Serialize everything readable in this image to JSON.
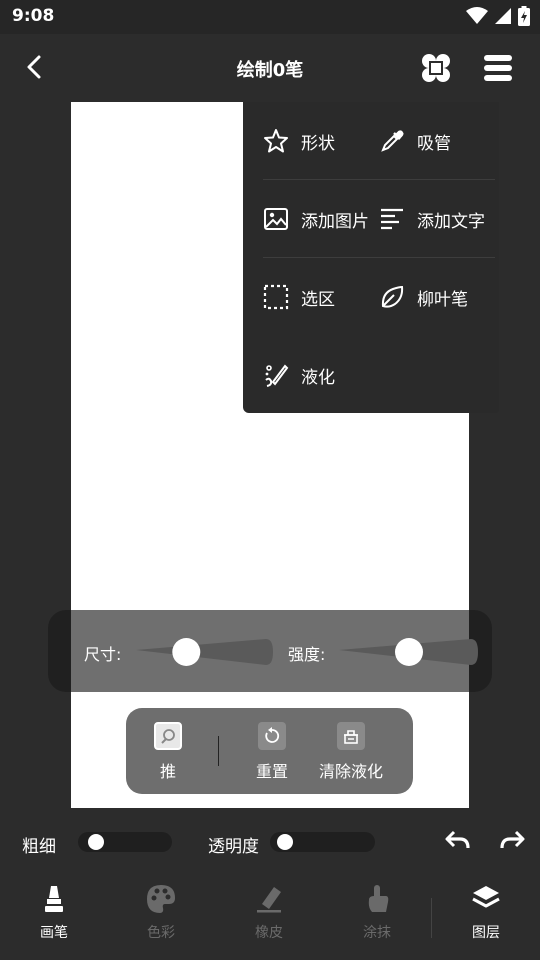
{
  "status_bar": {
    "time": "9:08"
  },
  "header": {
    "title": "绘制0笔"
  },
  "menu": {
    "items": [
      {
        "label": "形状",
        "icon": "star-icon"
      },
      {
        "label": "吸管",
        "icon": "eyedropper-icon"
      },
      {
        "label": "添加图片",
        "icon": "image-icon"
      },
      {
        "label": "添加文字",
        "icon": "text-lines-icon"
      },
      {
        "label": "选区",
        "icon": "selection-icon"
      },
      {
        "label": "柳叶笔",
        "icon": "leaf-icon"
      },
      {
        "label": "液化",
        "icon": "liquify-icon"
      }
    ]
  },
  "liquify_sliders": {
    "size_label": "尺寸:",
    "size_value": 0.33,
    "strength_label": "强度:",
    "strength_value": 0.5
  },
  "liquify_tools": {
    "push_label": "推",
    "reset_label": "重置",
    "clear_label": "清除液化"
  },
  "brush_controls": {
    "thickness_label": "粗细",
    "thickness_value": 0.1,
    "opacity_label": "透明度",
    "opacity_value": 0.05
  },
  "bottom_nav": {
    "items": [
      {
        "label": "画笔",
        "icon": "brush-icon",
        "active": true
      },
      {
        "label": "色彩",
        "icon": "palette-icon",
        "active": false
      },
      {
        "label": "橡皮",
        "icon": "eraser-icon",
        "active": false
      },
      {
        "label": "涂抹",
        "icon": "smudge-finger-icon",
        "active": false
      },
      {
        "label": "图层",
        "icon": "layers-icon",
        "active": true
      }
    ]
  },
  "colors": {
    "background": "#2c2c2c",
    "canvas": "#ffffff",
    "inactive_nav": "#6a6a6a"
  }
}
